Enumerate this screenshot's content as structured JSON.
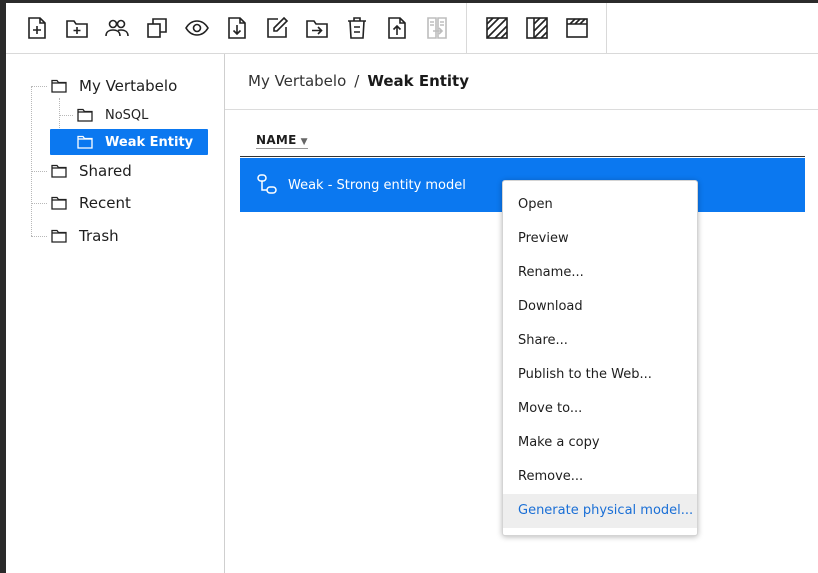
{
  "toolbar": {
    "buttons": [
      {
        "icon": "new-document-icon",
        "label": "New document"
      },
      {
        "icon": "new-folder-icon",
        "label": "New folder"
      },
      {
        "icon": "users-icon",
        "label": "Share"
      },
      {
        "icon": "copy-icon",
        "label": "Copy"
      },
      {
        "icon": "eye-icon",
        "label": "Preview"
      },
      {
        "icon": "download-icon",
        "label": "Download"
      },
      {
        "icon": "edit-icon",
        "label": "Edit"
      },
      {
        "icon": "move-to-folder-icon",
        "label": "Move"
      },
      {
        "icon": "trash-icon",
        "label": "Remove"
      },
      {
        "icon": "upload-icon",
        "label": "Upload"
      },
      {
        "icon": "compare-icon",
        "label": "Compare",
        "disabled": true
      }
    ],
    "view_buttons": [
      {
        "icon": "hatch-layout-icon"
      },
      {
        "icon": "split-layout-icon"
      },
      {
        "icon": "window-layout-icon"
      }
    ]
  },
  "sidebar": {
    "items": [
      {
        "label": "My Vertabelo",
        "level": 0
      },
      {
        "label": "NoSQL",
        "level": 1
      },
      {
        "label": "Weak Entity",
        "level": 1,
        "selected": true
      },
      {
        "label": "Shared",
        "level": 0
      },
      {
        "label": "Recent",
        "level": 0
      },
      {
        "label": "Trash",
        "level": 0
      }
    ]
  },
  "breadcrumb": {
    "root": "My Vertabelo",
    "separator": "/",
    "current": "Weak Entity"
  },
  "list": {
    "column_name": "NAME",
    "sort_indicator": "▼",
    "rows": [
      {
        "label": "Weak - Strong entity model",
        "icon": "model-icon",
        "selected": true
      }
    ]
  },
  "context_menu": {
    "items": [
      "Open",
      "Preview",
      "Rename...",
      "Download",
      "Share...",
      "Publish to the Web...",
      "Move to...",
      "Make a copy",
      "Remove...",
      "Generate physical model..."
    ],
    "highlighted_index": 9
  },
  "colors": {
    "accent": "#0b78f0",
    "menu_highlight_text": "#1a6fd6"
  }
}
